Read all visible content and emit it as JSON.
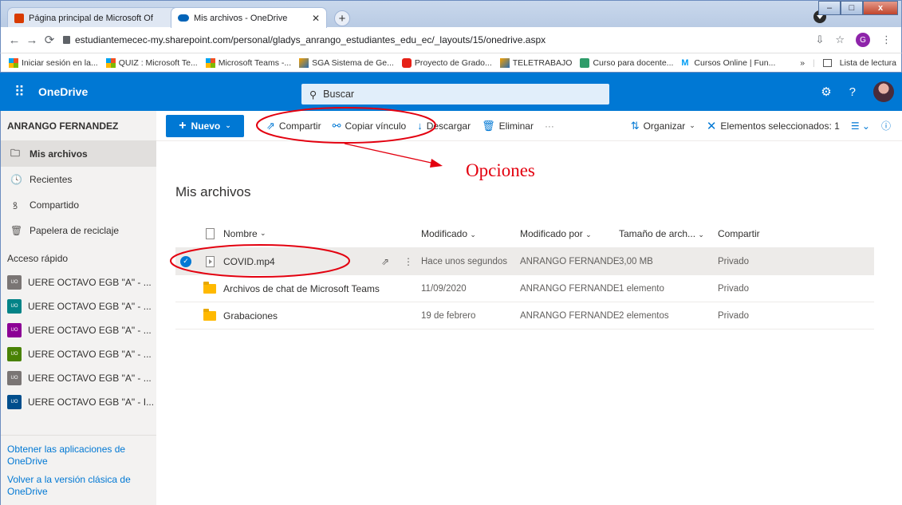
{
  "browser": {
    "tabs": [
      {
        "title": "Página principal de Microsoft Of",
        "active": false
      },
      {
        "title": "Mis archivos - OneDrive",
        "active": true
      }
    ],
    "url": "estudiantemecec-my.sharepoint.com/personal/gladys_anrango_estudiantes_edu_ec/_layouts/15/onedrive.aspx",
    "profile_initial": "G",
    "bookmarks": [
      {
        "label": "Iniciar sesión en la...",
        "icon": "microsoft-icon"
      },
      {
        "label": "QUIZ : Microsoft Te...",
        "icon": "microsoft-icon"
      },
      {
        "label": "Microsoft Teams -...",
        "icon": "microsoft-icon"
      },
      {
        "label": "SGA Sistema de Ge...",
        "icon": "sga-icon"
      },
      {
        "label": "Proyecto de Grado...",
        "icon": "youtube-icon"
      },
      {
        "label": "TELETRABAJO",
        "icon": "sga-icon"
      },
      {
        "label": "Curso para docente...",
        "icon": "course-icon"
      },
      {
        "label": "Cursos Online | Fun...",
        "icon": "movistar-icon"
      }
    ],
    "reading_list": "Lista de lectura"
  },
  "suite": {
    "brand": "OneDrive",
    "search_placeholder": "Buscar"
  },
  "sidebar": {
    "user": "ANRANGO FERNANDEZ",
    "nav": [
      {
        "label": "Mis archivos",
        "icon": "folder-icon",
        "glyph": "🗀",
        "selected": true
      },
      {
        "label": "Recientes",
        "icon": "clock-icon",
        "glyph": "🕓",
        "selected": false
      },
      {
        "label": "Compartido",
        "icon": "people-icon",
        "glyph": "ꝸ",
        "selected": false
      },
      {
        "label": "Papelera de reciclaje",
        "icon": "trash-icon",
        "glyph": "🗑",
        "selected": false
      }
    ],
    "quick_access_title": "Acceso rápido",
    "quick_access": [
      {
        "label": "UERE OCTAVO EGB \"A\" - ...",
        "badge": "UO",
        "color": "#7a7574"
      },
      {
        "label": "UERE OCTAVO EGB \"A\" - ...",
        "badge": "UO",
        "color": "#038387"
      },
      {
        "label": "UERE OCTAVO EGB \"A\" - ...",
        "badge": "UO",
        "color": "#8c0095"
      },
      {
        "label": "UERE OCTAVO EGB \"A\" - ...",
        "badge": "UO",
        "color": "#498205"
      },
      {
        "label": "UERE OCTAVO EGB \"A\" - ...",
        "badge": "UO",
        "color": "#7a7574"
      },
      {
        "label": "UERE OCTAVO EGB \"A\" - I...",
        "badge": "UO",
        "color": "#004e8c"
      }
    ],
    "links": [
      "Obtener las aplicaciones de OneDrive",
      "Volver a la versión clásica de OneDrive"
    ]
  },
  "commandbar": {
    "new": "Nuevo",
    "share": "Compartir",
    "copy_link": "Copiar vínculo",
    "download": "Descargar",
    "delete": "Eliminar",
    "more": "···",
    "sort": "Organizar",
    "selection": "Elementos seleccionados: 1"
  },
  "main": {
    "title": "Mis archivos",
    "annotation": "Opciones",
    "columns": {
      "name": "Nombre",
      "modified": "Modificado",
      "modified_by": "Modificado por",
      "size": "Tamaño de arch...",
      "sharing": "Compartir"
    },
    "rows": [
      {
        "name": "COVID.mp4",
        "type": "video",
        "modified": "Hace unos segundos",
        "modified_by": "ANRANGO FERNANDE...",
        "size": "3,00 MB",
        "sharing": "Privado",
        "selected": true
      },
      {
        "name": "Archivos de chat de Microsoft Teams",
        "type": "folder",
        "modified": "11/09/2020",
        "modified_by": "ANRANGO FERNANDE...",
        "size": "1 elemento",
        "sharing": "Privado",
        "selected": false
      },
      {
        "name": "Grabaciones",
        "type": "folder",
        "modified": "19 de febrero",
        "modified_by": "ANRANGO FERNANDE...",
        "size": "2 elementos",
        "sharing": "Privado",
        "selected": false
      }
    ]
  },
  "colors": {
    "accent": "#0078d4",
    "annotation": "#e3000f"
  }
}
